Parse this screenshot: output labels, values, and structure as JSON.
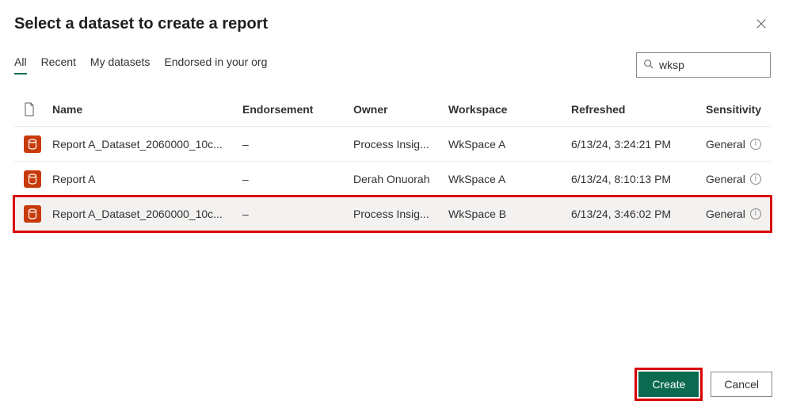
{
  "dialog": {
    "title": "Select a dataset to create a report"
  },
  "tabs": {
    "all": "All",
    "recent": "Recent",
    "my_datasets": "My datasets",
    "endorsed": "Endorsed in your org"
  },
  "search": {
    "value": "wksp"
  },
  "columns": {
    "name": "Name",
    "endorsement": "Endorsement",
    "owner": "Owner",
    "workspace": "Workspace",
    "refreshed": "Refreshed",
    "sensitivity": "Sensitivity"
  },
  "rows": [
    {
      "name": "Report A_Dataset_2060000_10c...",
      "endorsement": "–",
      "owner": "Process Insig...",
      "workspace": "WkSpace A",
      "refreshed": "6/13/24, 3:24:21 PM",
      "sensitivity": "General"
    },
    {
      "name": "Report A",
      "endorsement": "–",
      "owner": "Derah Onuorah",
      "workspace": "WkSpace A",
      "refreshed": "6/13/24, 8:10:13 PM",
      "sensitivity": "General"
    },
    {
      "name": "Report A_Dataset_2060000_10c...",
      "endorsement": "–",
      "owner": "Process Insig...",
      "workspace": "WkSpace B",
      "refreshed": "6/13/24, 3:46:02 PM",
      "sensitivity": "General"
    }
  ],
  "buttons": {
    "create": "Create",
    "cancel": "Cancel"
  }
}
